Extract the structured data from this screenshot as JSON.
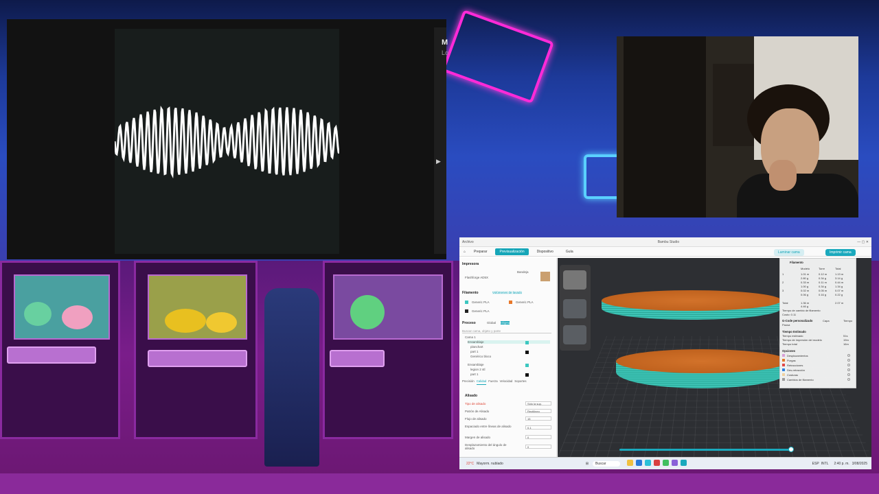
{
  "music": {
    "title": "M",
    "subtitle": "Lo",
    "next_icon": "▶"
  },
  "slicer": {
    "title": "Bambu Studio",
    "menu": {
      "file": "Archivo",
      "tabs": [
        "Preparar",
        "Previsualización",
        "Dispositivo",
        "Guía"
      ],
      "active_tab": "Previsualización"
    },
    "buttons": {
      "slice": "Laminar cama",
      "print": "Imprimir cama"
    },
    "panel": {
      "printer_head": "Impresora",
      "printer_name": "Flashforge AD5X",
      "plate_label": "Bandeja",
      "filament_head": "Filamento",
      "filament_btn": "Volúmenes de lavado",
      "filaments": [
        {
          "num": "1",
          "name": "Generic PLA",
          "color": "#3cc7c0"
        },
        {
          "num": "2",
          "name": "Generic PLA",
          "color": "#e8782a"
        },
        {
          "num": "3",
          "name": "Generic PLA",
          "color": "#222222"
        }
      ],
      "process_head": "Proceso",
      "process_global": "Global",
      "process_object": "Objeto",
      "search_placeholder": "Buscar cama, objeto y parte",
      "tree": [
        "Cama 1",
        "Ensamblaje",
        "planchart",
        "part 1",
        "Genérico bloco",
        "Ensamblaje",
        "legion 2 stl",
        "part 1"
      ],
      "settings_tabs": [
        "Precisión",
        "Calidad",
        "Fuerza",
        "Velocidad",
        "Soportes"
      ],
      "section": "Alisado",
      "rows": [
        {
          "label": "Tipo de alisado",
          "value": "Sólo la sup."
        },
        {
          "label": "Patrón de Alisado",
          "value": "Rectilíneo"
        },
        {
          "label": "Flujo de alisado",
          "value": "15"
        },
        {
          "label": "Espaciado entre líneas de alisado",
          "value": "0.1"
        },
        {
          "label": "Margen de alisado",
          "value": "0"
        },
        {
          "label": "Desplazamiento del ángulo de alisado",
          "value": "0"
        }
      ]
    },
    "legend": {
      "head": "Filamento",
      "cols": [
        "Modelo",
        "Torre",
        "Total"
      ],
      "filament_rows": [
        {
          "n": "1",
          "a": "1.01 m",
          "b": "0.12 m",
          "c": "1.13 m"
        },
        {
          "n": "",
          "a": "2.80 g",
          "b": "0.34 g",
          "c": "3.14 g"
        },
        {
          "n": "2",
          "a": "0.33 m",
          "b": "0.11 m",
          "c": "0.44 m"
        },
        {
          "n": "",
          "a": "1.00 g",
          "b": "0.34 g",
          "c": "1.34 g"
        },
        {
          "n": "3",
          "a": "0.02 m",
          "b": "0.05 m",
          "c": "0.07 m"
        },
        {
          "n": "",
          "a": "0.06 g",
          "b": "0.16 g",
          "c": "0.22 g"
        }
      ],
      "total_label": "Total",
      "total_a": "1.36 m",
      "total_b": "4.46 g",
      "total_c": "2.07 m",
      "changes": "Tiempo de cambio de filamento",
      "cost": "Costo: 0.11",
      "gcode_head": "G-Code personalizado",
      "layer_col": "Capa",
      "time_col": "Tiempo",
      "pause_row": "Pausa",
      "estimated": "Tiempo Estimado",
      "est_rows": [
        "Tiempo estimado",
        "Tiempo de impresión del modelo",
        "Tiempo total"
      ],
      "est_vals": [
        "51s",
        "19m",
        "16m"
      ],
      "options_head": "Opciones",
      "options": [
        "Desplazamientos",
        "Purgas",
        "Retracciones",
        "Des-retracción",
        "Costuras",
        "Cambios de filamento"
      ],
      "option_colors": [
        "#d8a0d8",
        "#e07a2a",
        "#e04848",
        "#2f7fe0",
        "#f0d0a0",
        "#9a9a9a"
      ]
    },
    "status_left": "22°C",
    "status_weather": "Mayorm. nublado",
    "search": "Buscar"
  },
  "taskbar": {
    "lang": "ESP",
    "lang2": "INTL",
    "time": "2:40 p. m.",
    "date": "3/08/2025"
  }
}
